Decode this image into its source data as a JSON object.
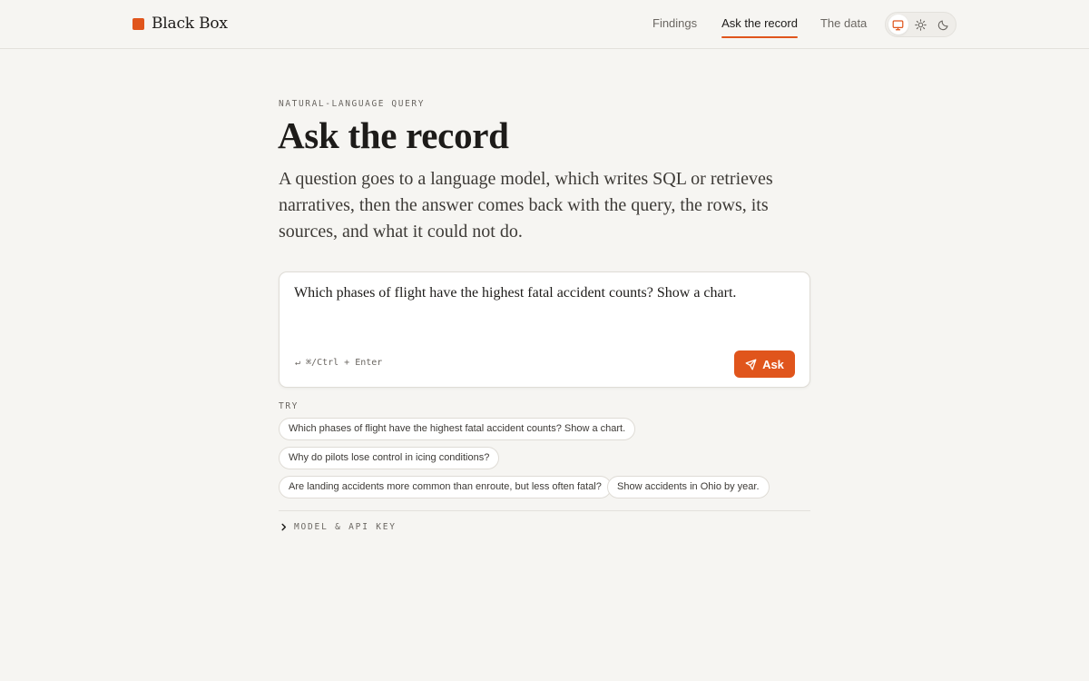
{
  "brand": {
    "name": "Black Box",
    "accent": "#e0551c"
  },
  "nav": {
    "items": [
      {
        "label": "Findings"
      },
      {
        "label": "Ask the record",
        "active": true
      },
      {
        "label": "The data"
      }
    ]
  },
  "theme_toggle": {
    "options": [
      {
        "icon": "monitor-icon",
        "active": true
      },
      {
        "icon": "sun-icon"
      },
      {
        "icon": "moon-icon"
      }
    ]
  },
  "page": {
    "eyebrow": "NATURAL-LANGUAGE QUERY",
    "title": "Ask the record",
    "lede": "A question goes to a language model, which writes SQL or retrieves narratives, then the answer comes back with the query, the rows, its sources, and what it could not do."
  },
  "query": {
    "value": "Which phases of flight have the highest fatal accident counts? Show a chart.",
    "shortcut": "↵ ⌘/Ctrl + Enter",
    "submit_label": "Ask"
  },
  "suggestions": {
    "label": "TRY",
    "items": [
      "Which phases of flight have the highest fatal accident counts? Show a chart.",
      "Why do pilots lose control in icing conditions?",
      "Are landing accidents more common than enroute, but less often fatal?",
      "Show accidents in Ohio by year."
    ]
  },
  "settings": {
    "label": "MODEL & API KEY",
    "expanded": false
  }
}
